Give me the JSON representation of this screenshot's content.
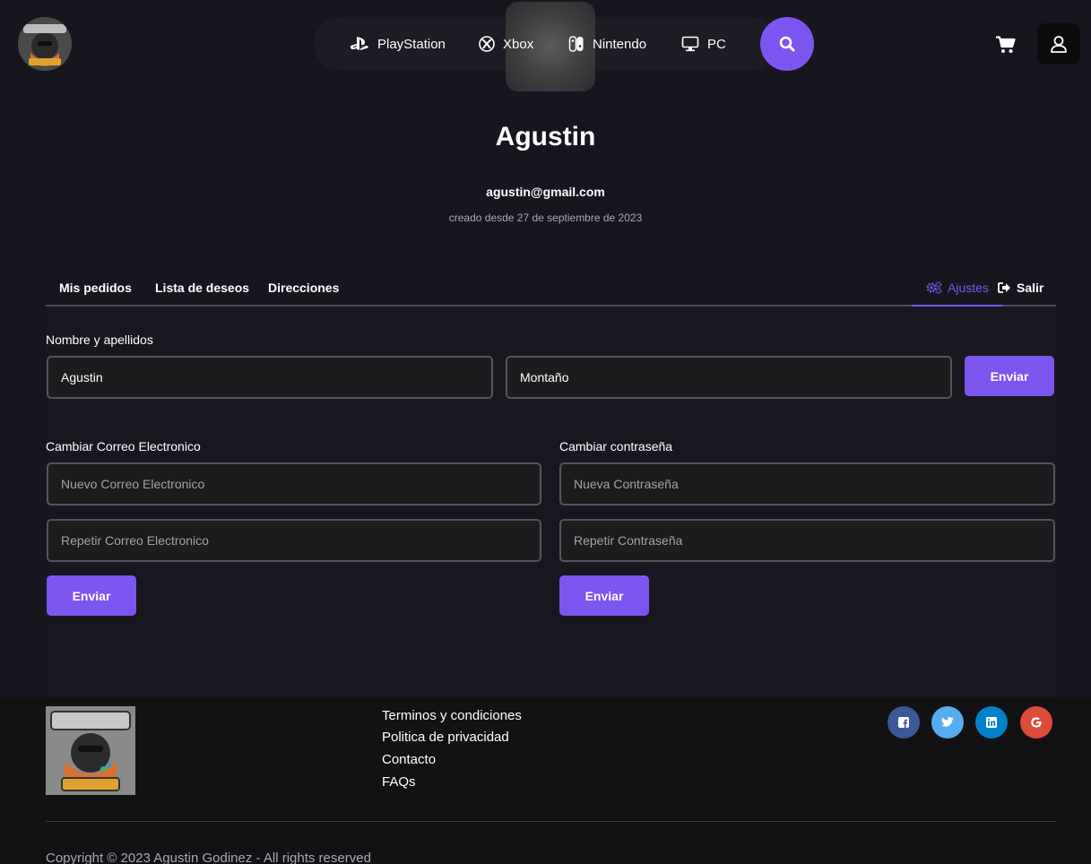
{
  "brand": {
    "logo_text_top": "GUS-UPS",
    "logo_text_bottom": "GUSSIFF"
  },
  "nav": {
    "items": [
      {
        "label": "PlayStation",
        "icon": "playstation-icon"
      },
      {
        "label": "Xbox",
        "icon": "xbox-icon"
      },
      {
        "label": "Nintendo",
        "icon": "nintendo-switch-icon"
      },
      {
        "label": "PC",
        "icon": "monitor-icon"
      }
    ],
    "search_icon": "search-icon",
    "cart_icon": "cart-icon",
    "user_icon": "user-icon"
  },
  "profile": {
    "name": "Agustin",
    "email": "agustin@gmail.com",
    "created": "creado desde 27 de septiembre de 2023"
  },
  "tabs": {
    "left": [
      "Mis pedidos",
      "Lista de deseos",
      "Direcciones"
    ],
    "settings_label": "Ajustes",
    "logout_label": "Salir",
    "active": "Ajustes"
  },
  "form": {
    "name_section": {
      "label": "Nombre y apellidos",
      "first_name_value": "Agustin",
      "last_name_value": "Montaño",
      "submit_label": "Enviar"
    },
    "email_section": {
      "label": "Cambiar Correo Electronico",
      "new_placeholder": "Nuevo Correo Electronico",
      "repeat_placeholder": "Repetir Correo Electronico",
      "submit_label": "Enviar"
    },
    "password_section": {
      "label": "Cambiar contraseña",
      "new_placeholder": "Nueva Contraseña",
      "repeat_placeholder": "Repetir Contraseña",
      "submit_label": "Enviar"
    }
  },
  "footer": {
    "links": [
      "Terminos y condiciones",
      "Politica de privacidad",
      "Contacto",
      "FAQs"
    ],
    "social": [
      {
        "name": "facebook-icon",
        "color": "#3b5998"
      },
      {
        "name": "twitter-icon",
        "color": "#55acee"
      },
      {
        "name": "linkedin-icon",
        "color": "#0082ca"
      },
      {
        "name": "google-icon",
        "color": "#dd4b39"
      }
    ],
    "copyright": "Copyright © 2023 Agustin Godinez - All rights reserved"
  },
  "colors": {
    "accent": "#7c55f1",
    "background": "#17161f",
    "footer_background": "#121214"
  }
}
